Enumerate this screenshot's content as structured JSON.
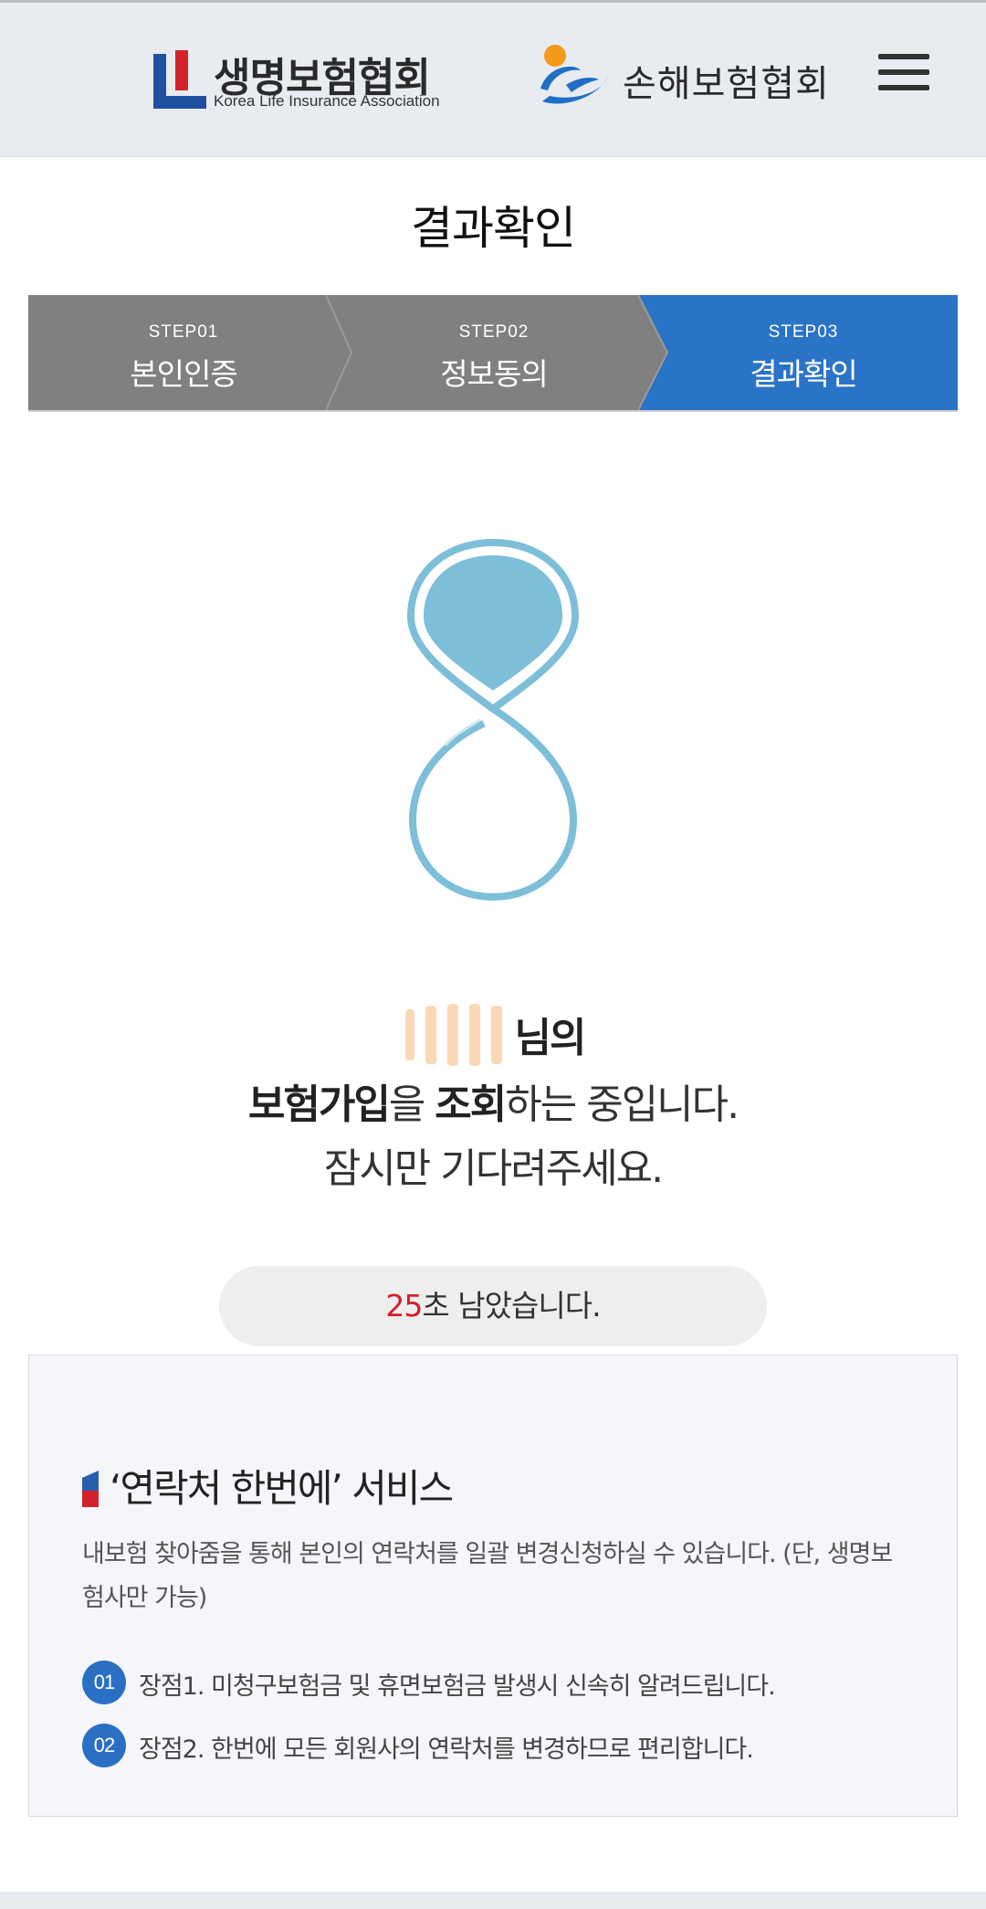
{
  "header": {
    "logo_left_ko": "생명보험협회",
    "logo_left_en": "Korea Life Insurance Association",
    "logo_right_ko": "손해보험협회",
    "menu_icon": "hamburger-menu-icon"
  },
  "page": {
    "title": "결과확인"
  },
  "steps": [
    {
      "num": "STEP01",
      "label": "본인인증",
      "active": false
    },
    {
      "num": "STEP02",
      "label": "정보동의",
      "active": false
    },
    {
      "num": "STEP03",
      "label": "결과확인",
      "active": true
    }
  ],
  "colors": {
    "step_inactive": "#808080",
    "step_active": "#2a74c8",
    "spinner": "#7dbfd9",
    "countdown_seconds": "#d0202a",
    "badge": "#2a6fc4"
  },
  "message": {
    "name_suffix": "님의",
    "line2_bold1": "보험가입",
    "line2_part1": "을 ",
    "line2_bold2": "조회",
    "line2_part2": "하는 중입니다.",
    "line3": "잠시만 기다려주세요."
  },
  "countdown": {
    "seconds": "25",
    "text": "초 남았습니다."
  },
  "info": {
    "title": "‘연락처 한번에’ 서비스",
    "description": "내보험 찾아줌을 통해 본인의 연락처를 일괄 변경신청하실 수 있습니다. (단, 생명보험사만 가능)",
    "benefits": [
      {
        "badge": "01",
        "text": "장점1. 미청구보험금 및 휴면보험금 발생시 신속히 알려드립니다."
      },
      {
        "badge": "02",
        "text": "장점2. 한번에 모든 회원사의 연락처를 변경하므로 편리합니다."
      }
    ]
  }
}
